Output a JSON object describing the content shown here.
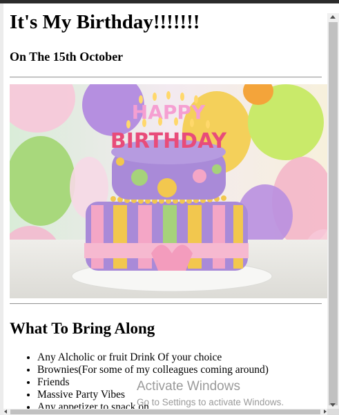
{
  "page": {
    "title": "It's My Birthday!!!!!!!",
    "date_heading": "On The 15th October",
    "section_heading": "What To Bring Along",
    "items": [
      "Any Alcholic or fruit Drink Of your choice",
      "Brownies(For some of my colleagues coming around)",
      "Friends",
      "Massive Party Vibes",
      "Any appetizer to snack on"
    ]
  },
  "hero_image": {
    "cake_text_top": "HAPPY",
    "cake_text_bottom": "BIRTHDAY"
  },
  "watermark": {
    "title": "Activate Windows",
    "subtitle": "Go to Settings to activate Windows."
  },
  "colors": {
    "cake_purple": "#a98ad8",
    "cake_yellow": "#f2c74e",
    "cake_pink": "#f4a6c6",
    "cake_green": "#a6d27a"
  }
}
